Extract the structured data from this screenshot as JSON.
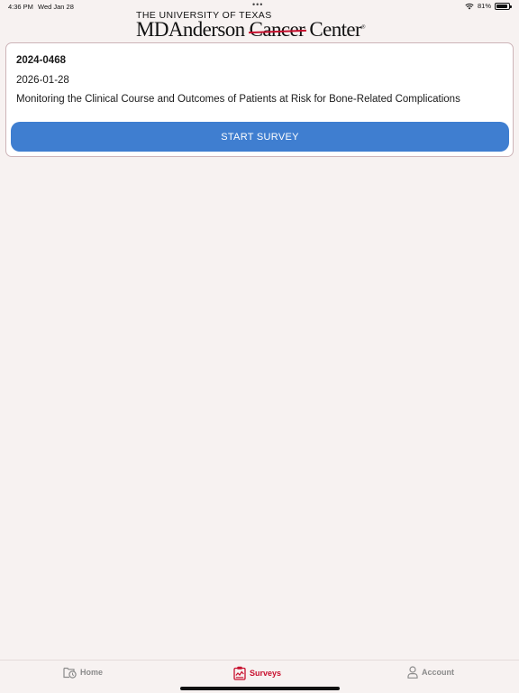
{
  "status_bar": {
    "time": "4:36 PM",
    "date": "Wed Jan 28",
    "more": "•••",
    "battery_percent": "81%",
    "battery_level": 0.81,
    "icons": [
      "wifi-icon",
      "battery-icon"
    ]
  },
  "header": {
    "logo_top": "THE UNIVERSITY OF TEXAS",
    "logo_word_1": "MD",
    "logo_word_2": "Anderson",
    "logo_word_3": "Cancer",
    "logo_word_4": "Center",
    "logo_mark": "®"
  },
  "survey": {
    "id": "2024-0468",
    "date": "2026-01-28",
    "title": "Monitoring the Clinical Course and Outcomes of Patients at Risk for Bone-Related Complications",
    "button_label": "START SURVEY"
  },
  "tabs": [
    {
      "label": "Home",
      "icon": "calendar-clock-icon",
      "active": false
    },
    {
      "label": "Surveys",
      "icon": "clipboard-chart-icon",
      "active": true
    },
    {
      "label": "Account",
      "icon": "person-icon",
      "active": false
    }
  ],
  "colors": {
    "background": "#f7f2f1",
    "accent": "#c8102e",
    "button": "#3f7ed0",
    "inactive_tab": "#8b8b8b"
  }
}
